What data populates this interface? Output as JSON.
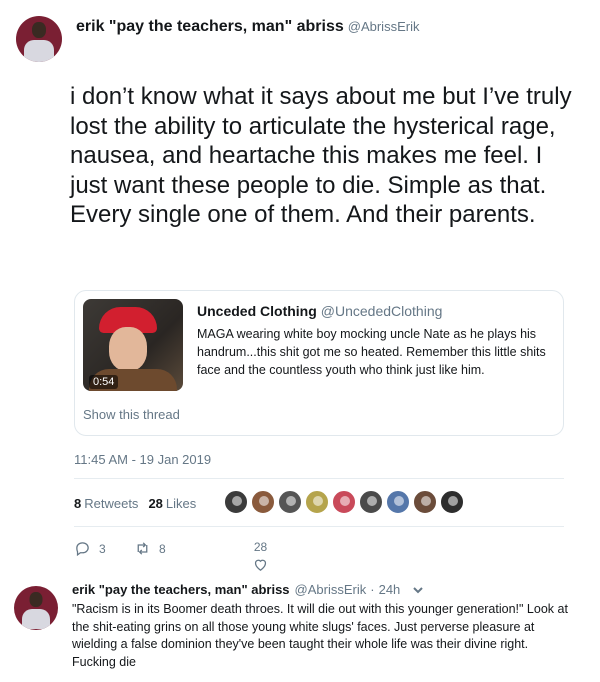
{
  "main_tweet": {
    "author_name": "erik \"pay the teachers, man\" abriss",
    "author_handle": "@AbrissErik",
    "text": "i don’t know what it says about me but I’ve truly lost the ability to articulate the hysterical rage, nausea, and heartache this makes me feel. I just want these people to die. Simple as that. Every single one of them. And their parents.",
    "timestamp": "11:45 AM - 19 Jan 2019"
  },
  "quoted_tweet": {
    "author_name": "Unceded Clothing",
    "author_handle": "@UncededClothing",
    "text": "MAGA wearing white boy mocking uncle Nate as he plays his handrum...this shit got me so heated. Remember this little shits face and the countless youth who think just like him.",
    "video_duration": "0:54",
    "show_thread_label": "Show this thread"
  },
  "stats": {
    "retweets_count": "8",
    "retweets_label": "Retweets",
    "likes_count": "28",
    "likes_label": "Likes",
    "liker_avatar_colors": [
      "#3b3b3b",
      "#8a5a3c",
      "#555555",
      "#b5a44c",
      "#c94a5a",
      "#4a4a4a",
      "#5577aa",
      "#6b4c3a",
      "#2d2d2d"
    ]
  },
  "actions": {
    "reply_count": "3",
    "retweet_count": "8",
    "like_count": "28"
  },
  "reply": {
    "author_name": "erik \"pay the teachers, man\" abriss",
    "author_handle": "@AbrissErik",
    "separator": "·",
    "time": "24h",
    "text": "\"Racism is in its Boomer death throes. It will die out with this younger generation!\" Look at the shit-eating grins on all those young white slugs' faces. Just perverse pleasure at wielding a false dominion they've been taught their whole life was their divine right. Fucking die"
  }
}
